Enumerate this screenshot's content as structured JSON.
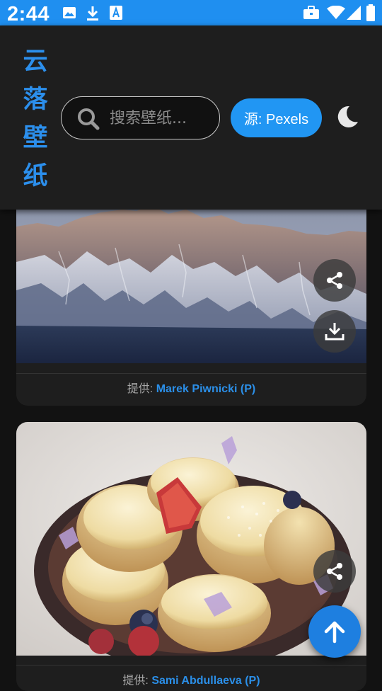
{
  "status_bar": {
    "time": "2:44",
    "left_icons": [
      "image-icon",
      "download-icon",
      "font-icon"
    ],
    "right_icons": [
      "briefcase-icon",
      "wifi-icon",
      "signal-icon",
      "battery-icon"
    ]
  },
  "header": {
    "title_chars": [
      "云",
      "落",
      "壁",
      "纸"
    ],
    "search_placeholder": "搜索壁纸...",
    "source_label": "源: Pexels",
    "theme_icon": "moon-icon"
  },
  "cards": [
    {
      "image": "snowy-mountain-peaks",
      "credit_prefix": "提供:",
      "author": "Marek Piwnicki (P)",
      "actions": [
        "share-icon",
        "download-icon"
      ]
    },
    {
      "image": "syrniki-pancakes-dessert",
      "credit_prefix": "提供:",
      "author": "Sami Abdullaeva (P)",
      "actions": [
        "share-icon"
      ]
    }
  ],
  "fab_icon": "arrow-up-icon",
  "colors": {
    "accent": "#2196f3",
    "status_bar": "#1f8ff0",
    "surface": "#1e1e1e",
    "background": "#121212"
  }
}
